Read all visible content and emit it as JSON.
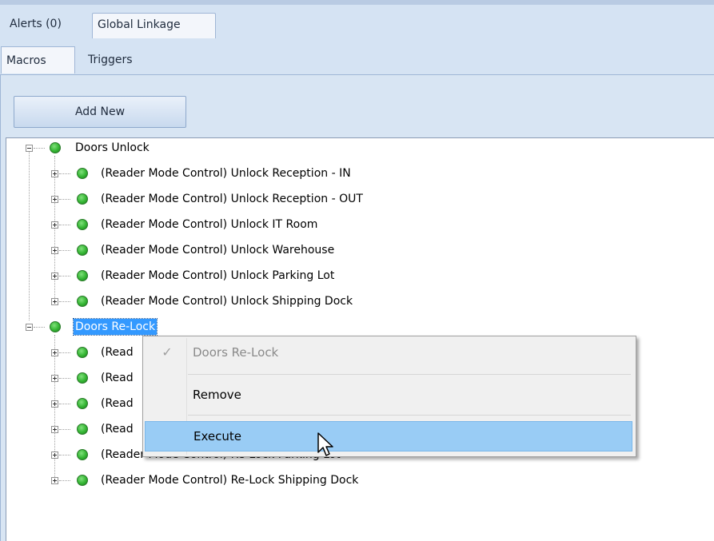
{
  "tabs": {
    "alerts": "Alerts (0)",
    "global_linkage": "Global Linkage"
  },
  "subtabs": {
    "macros": "Macros",
    "triggers": "Triggers"
  },
  "add_new": "Add New",
  "tree": {
    "groups": [
      {
        "label": "Doors Unlock",
        "children": [
          "(Reader Mode Control) Unlock Reception - IN",
          "(Reader Mode Control) Unlock Reception - OUT",
          "(Reader Mode Control) Unlock IT Room",
          "(Reader Mode Control) Unlock Warehouse",
          "(Reader Mode Control) Unlock Parking Lot",
          "(Reader Mode Control) Unlock Shipping Dock"
        ]
      },
      {
        "label": "Doors Re-Lock",
        "children": [
          "(Read",
          "(Read",
          "(Read",
          "(Read",
          "(Reader Mode Control) Re-Lock Parking Lot",
          "(Reader Mode Control) Re-Lock Shipping Dock"
        ]
      }
    ]
  },
  "context_menu": {
    "title": "Doors Re-Lock",
    "remove": "Remove",
    "execute": "Execute"
  },
  "colors": {
    "status_dot": "#34b533",
    "selection": "#3399ff",
    "menu_hover": "#99ccf5"
  },
  "icons": {
    "status": "green-circle-icon",
    "expand": "plus-box-icon",
    "collapse": "minus-box-icon",
    "check": "checkmark-icon",
    "cursor": "arrow-cursor-icon"
  }
}
